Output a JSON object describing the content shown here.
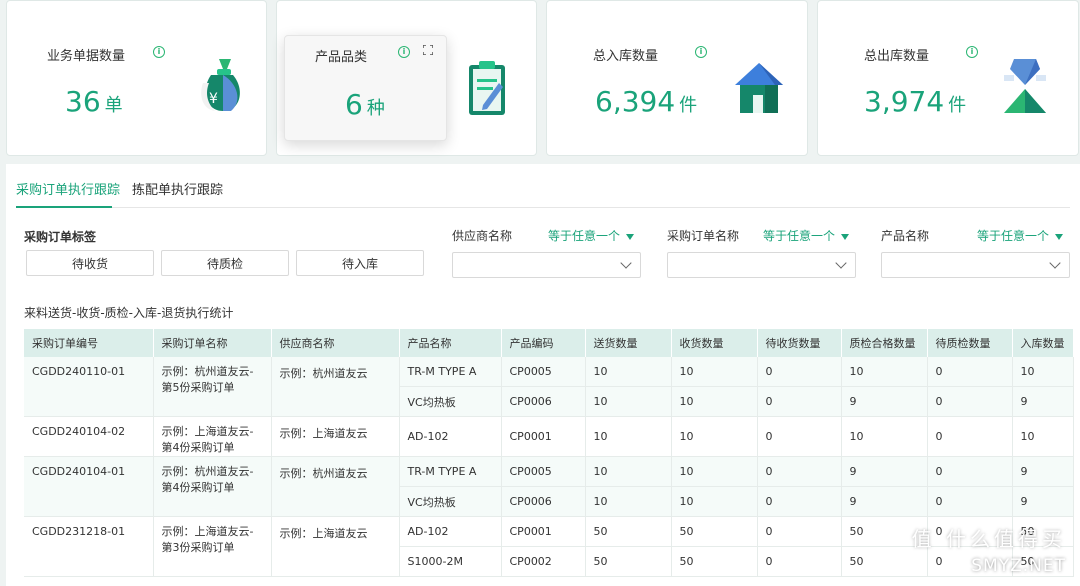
{
  "stats": [
    {
      "title": "业务单据数量",
      "value": "36",
      "unit": "单",
      "icon": "money-bag-icon",
      "info_glyph": "i"
    },
    {
      "title": "产品品类",
      "value": "6",
      "unit": "种",
      "icon": "clipboard-icon",
      "info_glyph": "i"
    },
    {
      "title": "总入库数量",
      "value": "6,394",
      "unit": "件",
      "icon": "house-icon",
      "info_glyph": "i"
    },
    {
      "title": "总出库数量",
      "value": "3,974",
      "unit": "件",
      "icon": "crystal-pyramid-icon",
      "info_glyph": "i"
    }
  ],
  "tabs": [
    {
      "label": "采购订单执行跟踪",
      "active": true
    },
    {
      "label": "拣配单执行跟踪",
      "active": false
    }
  ],
  "filters": {
    "tag_label": "采购订单标签",
    "tag_buttons": [
      "待收货",
      "待质检",
      "待入库"
    ],
    "fields": [
      {
        "label": "供应商名称",
        "operator": "等于任意一个"
      },
      {
        "label": "采购订单名称",
        "operator": "等于任意一个"
      },
      {
        "label": "产品名称",
        "operator": "等于任意一个"
      }
    ]
  },
  "section_title": "来料送货-收货-质检-入库-退货执行统计",
  "table": {
    "columns": [
      "采购订单编号",
      "采购订单名称",
      "供应商名称",
      "产品名称",
      "产品编码",
      "送货数量",
      "收货数量",
      "待收货数量",
      "质检合格数量",
      "待质检数量",
      "入库数量"
    ],
    "groups": [
      {
        "order_no": "CGDD240110-01",
        "order_name": "示例：杭州道友云-第5份采购订单",
        "supplier": "示例：杭州道友云",
        "lines": [
          [
            "TR-M TYPE A",
            "CP0005",
            "10",
            "10",
            "0",
            "10",
            "0",
            "10"
          ],
          [
            "VC均热板",
            "CP0006",
            "10",
            "10",
            "0",
            "9",
            "0",
            "9"
          ]
        ]
      },
      {
        "order_no": "CGDD240104-02",
        "order_name": "示例：上海道友云-第4份采购订单",
        "supplier": "示例：上海道友云",
        "lines": [
          [
            "AD-102",
            "CP0001",
            "10",
            "10",
            "0",
            "10",
            "0",
            "10"
          ]
        ]
      },
      {
        "order_no": "CGDD240104-01",
        "order_name": "示例：杭州道友云-第4份采购订单",
        "supplier": "示例：杭州道友云",
        "lines": [
          [
            "TR-M TYPE A",
            "CP0005",
            "10",
            "10",
            "0",
            "9",
            "0",
            "9"
          ],
          [
            "VC均热板",
            "CP0006",
            "10",
            "10",
            "0",
            "9",
            "0",
            "9"
          ]
        ]
      },
      {
        "order_no": "CGDD231218-01",
        "order_name": "示例：上海道友云-第3份采购订单",
        "supplier": "示例：上海道友云",
        "lines": [
          [
            "AD-102",
            "CP0001",
            "50",
            "50",
            "0",
            "50",
            "0",
            "50"
          ],
          [
            "S1000-2M",
            "CP0002",
            "50",
            "50",
            "0",
            "50",
            "0",
            "50"
          ]
        ]
      }
    ]
  },
  "watermark": {
    "line1": "值 什么值得买",
    "line2": "SMYZ.NET"
  },
  "colors": {
    "accent": "#1aa37a",
    "header_bg": "#dbeeea",
    "row_alt": "#f5fbf9",
    "page_bg": "#eef3f2"
  }
}
